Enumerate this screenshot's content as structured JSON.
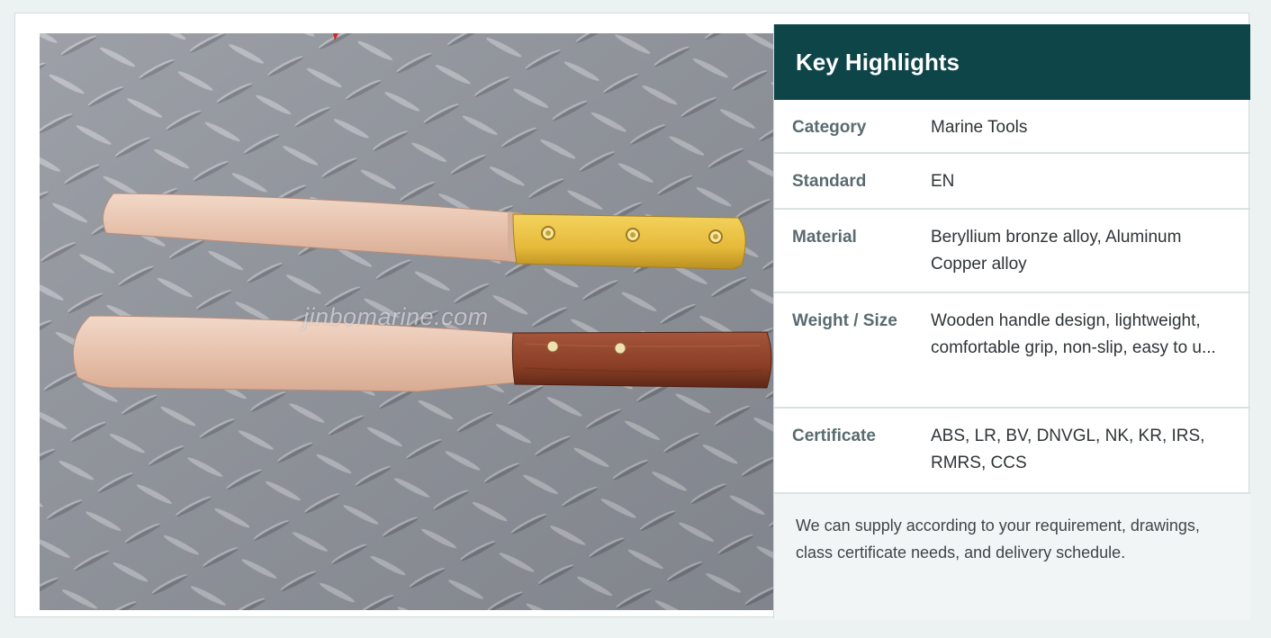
{
  "photo": {
    "watermark": "jinbomarine.com"
  },
  "highlights": {
    "title": "Key Highlights",
    "rows": [
      {
        "label": "Category",
        "value": "Marine Tools"
      },
      {
        "label": "Standard",
        "value": "EN"
      },
      {
        "label": "Material",
        "value": "Beryllium bronze alloy, Aluminum Copper alloy"
      },
      {
        "label": "Weight / Size",
        "value": "Wooden handle design, lightweight, comfortable grip, non-slip, easy to u..."
      },
      {
        "label": "Certificate",
        "value": "ABS, LR, BV, DNVGL, NK, KR, IRS, RMRS, CCS"
      }
    ],
    "note": "We can supply according to your requirement, drawings, class certificate needs, and delivery schedule."
  },
  "colors": {
    "header_bg": "#0e4549",
    "label_text": "#5a6b70",
    "divider": "#d9e2e3"
  }
}
